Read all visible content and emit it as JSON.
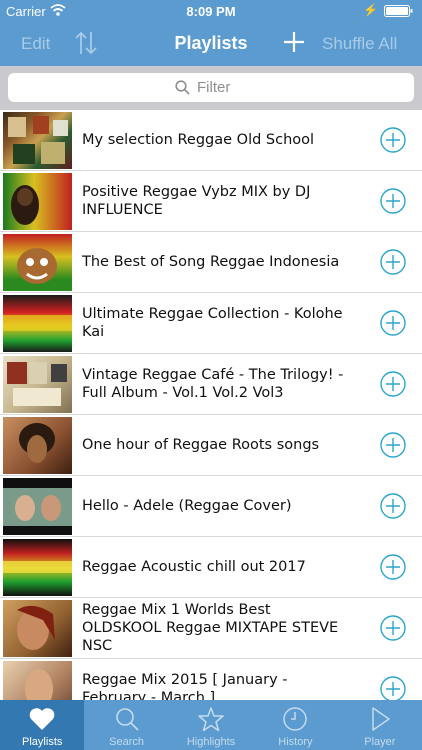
{
  "status_bar": {
    "carrier": "Carrier",
    "time": "8:09 PM"
  },
  "nav": {
    "edit_label": "Edit",
    "title": "Playlists",
    "shuffle_label": "Shuffle All"
  },
  "search": {
    "placeholder": "Filter"
  },
  "playlists": [
    {
      "title": "My selection Reggae Old School"
    },
    {
      "title": "Positive Reggae Vybz MIX  by DJ INFLUENCE"
    },
    {
      "title": "The Best of Song Reggae Indonesia"
    },
    {
      "title": "Ultimate Reggae Collection - Kolohe Kai"
    },
    {
      "title": "Vintage Reggae Café - The Trilogy! - Full Album - Vol.1 Vol.2 Vol3"
    },
    {
      "title": "One hour of Reggae Roots songs"
    },
    {
      "title": "Hello - Adele (Reggae Cover)"
    },
    {
      "title": "Reggae Acoustic chill out 2017"
    },
    {
      "title": "Reggae Mix 1 Worlds Best OLDSKOOL Reggae MIXTAPE STEVE NSC"
    },
    {
      "title": "Reggae Mix 2015 [ January - February - March ]"
    }
  ],
  "tabs": [
    {
      "label": "Playlists",
      "icon": "heart-icon",
      "active": true
    },
    {
      "label": "Search",
      "icon": "magnifier-icon"
    },
    {
      "label": "Highlights",
      "icon": "star-icon"
    },
    {
      "label": "History",
      "icon": "clock-icon"
    },
    {
      "label": "Player",
      "icon": "play-icon"
    }
  ],
  "colors": {
    "accent": "#5b9bd0",
    "tab_active": "#3478b2",
    "add_button": "#2ba6c9"
  }
}
